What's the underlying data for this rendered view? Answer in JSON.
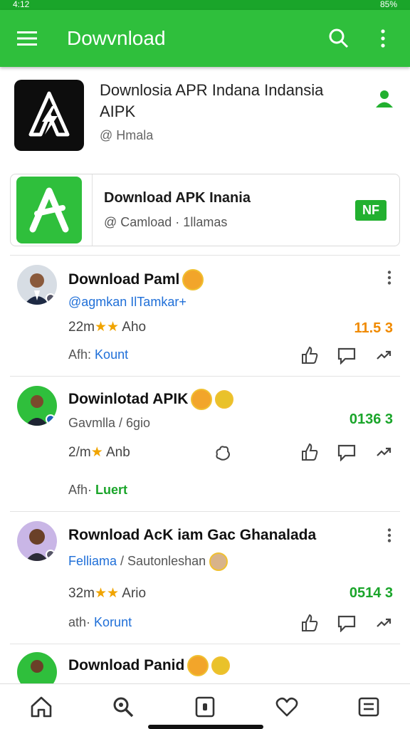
{
  "statusbar": {
    "left": "4:12",
    "right": "85%"
  },
  "appbar": {
    "title": "Dowvnload"
  },
  "app": {
    "name": "Downlosia APR Indana Indansia AIPK",
    "author": "@ Hmala"
  },
  "card": {
    "name": "Download APK Inania",
    "author": "@ Camload · 1llamas",
    "badge": "NF"
  },
  "posts": [
    {
      "name": "Download Paml",
      "handle": "@agmkan IlTamkar+",
      "meta_left": "22m",
      "meta_right": "Aho",
      "count": "11.5 3",
      "foot_label": "Afh:",
      "foot_link": "Kount"
    },
    {
      "name": "Dowinlotad APIK",
      "handle": "Gavmlla / 6gio",
      "meta_left": "2/m",
      "meta_right": "Anb",
      "count": "0136 3",
      "foot_label": "Afh·",
      "foot_link": "Luert"
    },
    {
      "name": "Rownload AcK iam Gac Ghanalada",
      "handle": "Felliama",
      "handle2": "/ Sautonleshan",
      "meta_left": "32m",
      "meta_right": "Ario",
      "count": "0514 3",
      "foot_label": "ath·",
      "foot_link": "Korunt"
    },
    {
      "name": "Download Panid"
    }
  ],
  "colors": {
    "primary": "#2fbf3c",
    "link": "#1f6fd8",
    "star": "#f0a400",
    "count_orange": "#f08a00",
    "count_green": "#1aa52a"
  }
}
